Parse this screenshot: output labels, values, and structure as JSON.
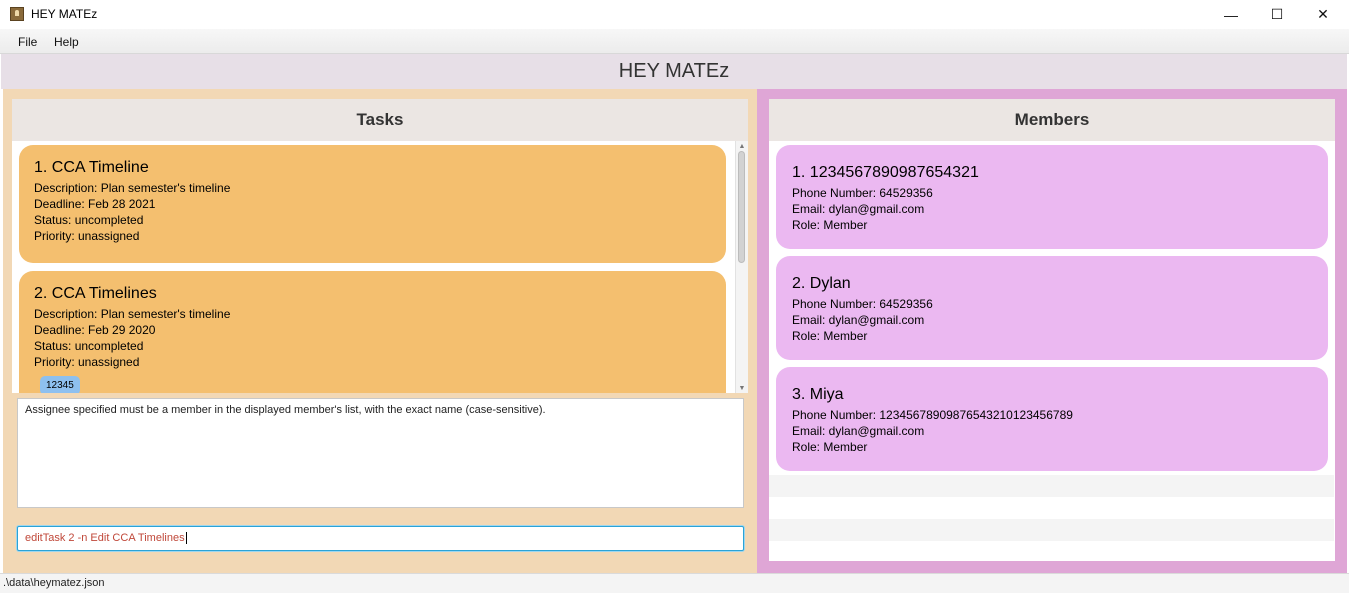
{
  "window": {
    "title": "HEY MATEz",
    "minimize_glyph": "—",
    "maximize_glyph": "☐",
    "close_glyph": "✕"
  },
  "menu": [
    "File",
    "Help"
  ],
  "app_header": "HEY MATEz",
  "tasks_panel": {
    "title": "Tasks",
    "tasks": [
      {
        "title": "1.  CCA Timeline",
        "description": "Description: Plan semester's timeline",
        "deadline": "Deadline: Feb 28 2021",
        "status": "Status: uncompleted",
        "priority": "Priority: unassigned"
      },
      {
        "title": "2.  CCA Timelines",
        "description": "Description: Plan semester's timeline",
        "deadline": "Deadline: Feb 29 2020",
        "status": "Status: uncompleted",
        "priority": "Priority: unassigned",
        "tag": "12345"
      }
    ]
  },
  "result_message": "Assignee specified must be a member in the displayed member's list, with the exact name (case-sensitive).",
  "command_input": "editTask 2 -n Edit CCA Timelines",
  "members_panel": {
    "title": "Members",
    "members": [
      {
        "title": "1.  1234567890987654321",
        "phone": "Phone Number: 64529356",
        "email": "Email: dylan@gmail.com",
        "role": "Role: Member"
      },
      {
        "title": "2.  Dylan",
        "phone": "Phone Number: 64529356",
        "email": "Email: dylan@gmail.com",
        "role": "Role: Member"
      },
      {
        "title": "3.  Miya",
        "phone": "Phone Number: 12345678909876543210123456789",
        "email": "Email: dylan@gmail.com",
        "role": "Role: Member"
      }
    ]
  },
  "status_bar": ".\\data\\heymatez.json",
  "colors": {
    "task_card": "#f4bf6f",
    "member_card": "#ebb8f1",
    "left_background": "#f2d8b5",
    "right_background": "#dfa6d6",
    "tag": "#8ec0ef",
    "command_text": "#c0483a"
  },
  "icons": {
    "app": "app-icon",
    "scroll_up": "scroll-up-arrow-icon",
    "scroll_down": "scroll-down-arrow-icon"
  }
}
